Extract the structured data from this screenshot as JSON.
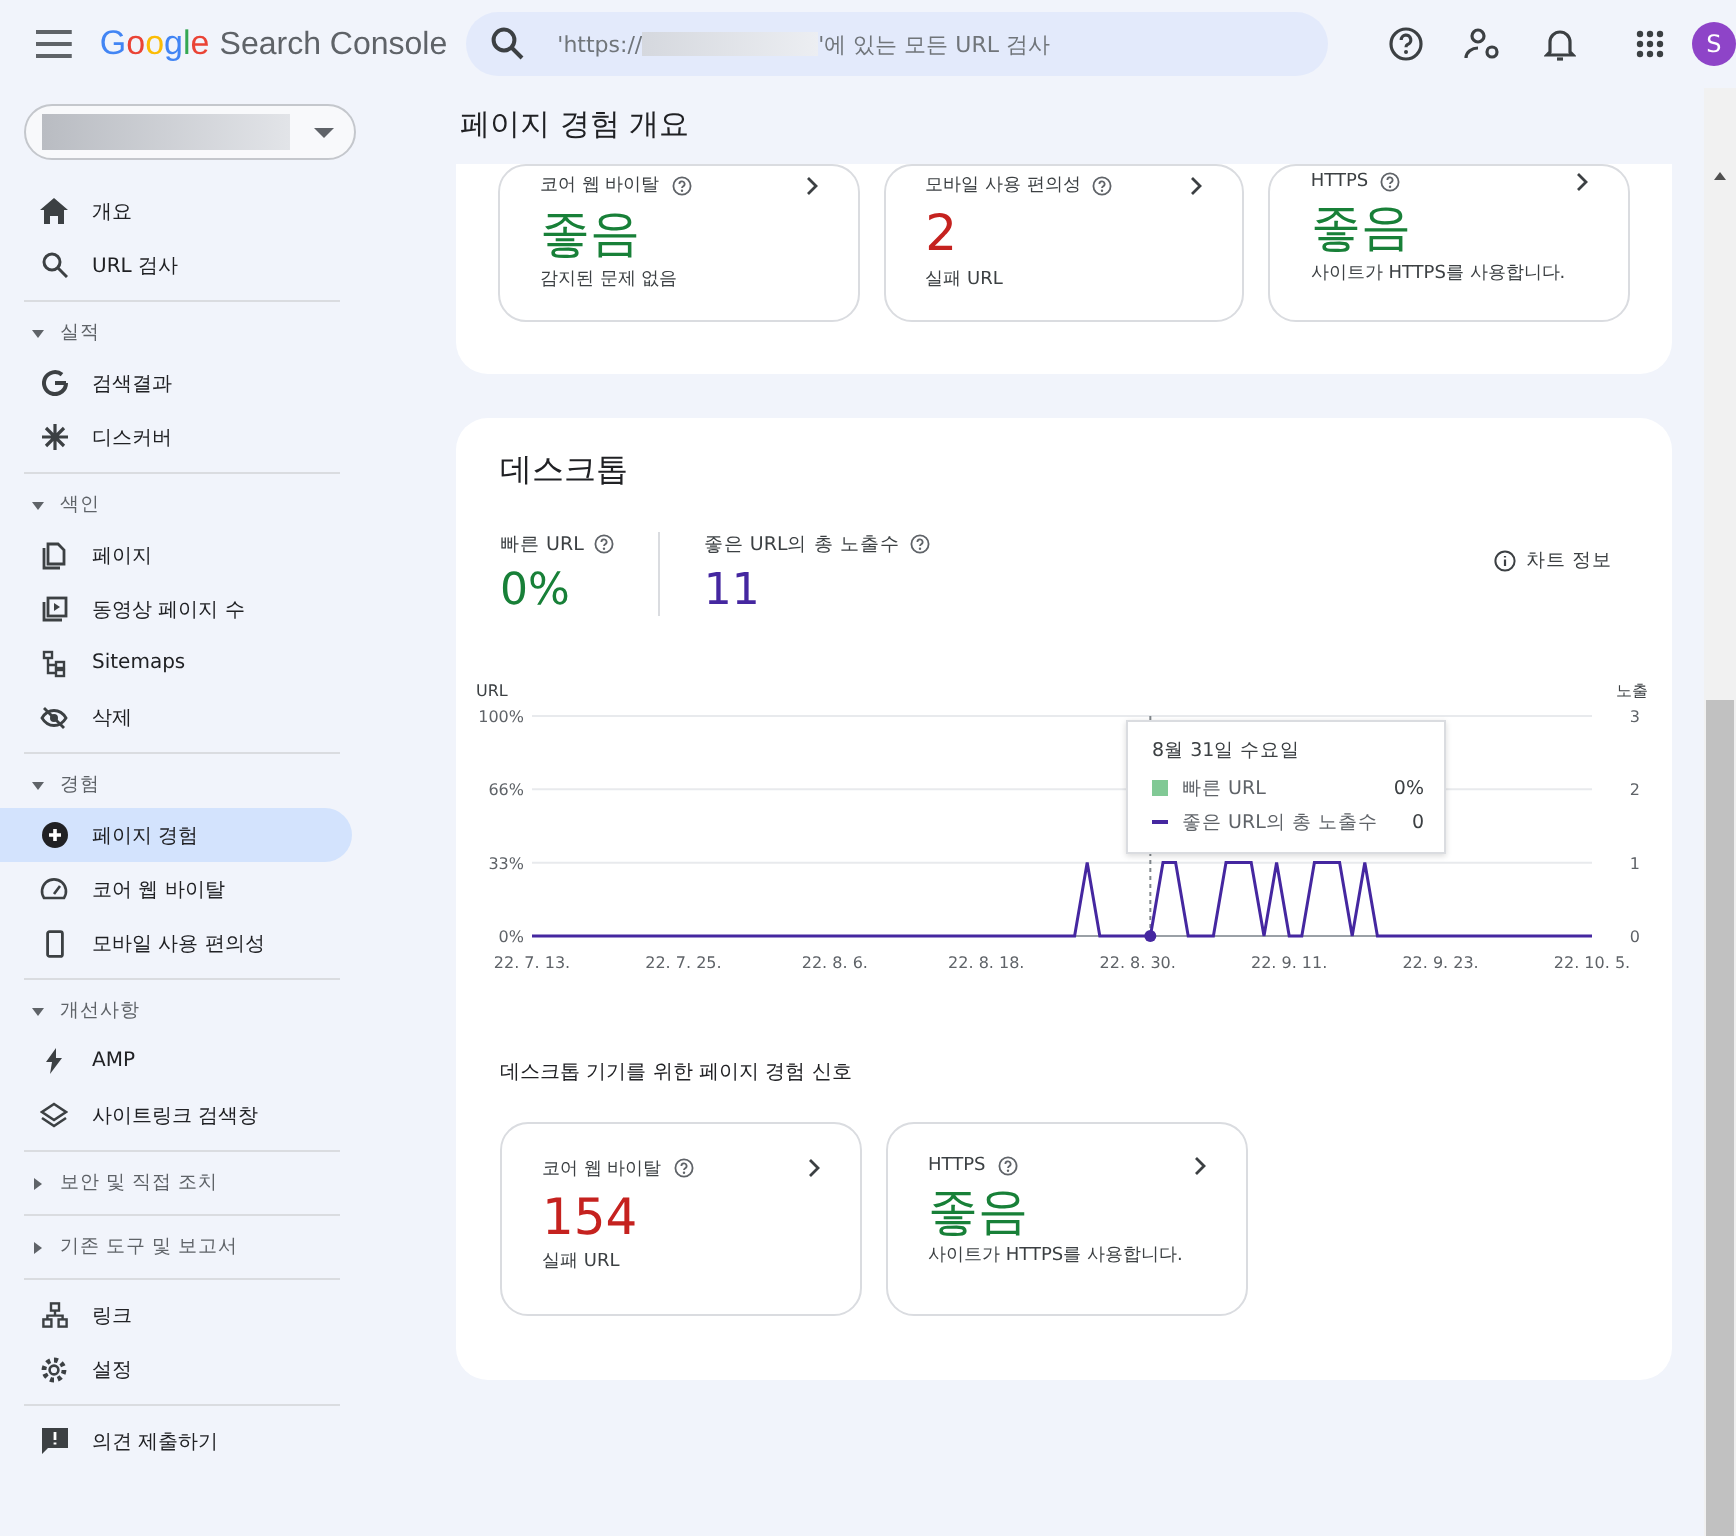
{
  "header": {
    "logo": {
      "brand": "Google",
      "product": "Search Console"
    },
    "search": {
      "prefix": "'https://",
      "suffix": "'에 있는 모든 URL 검사"
    },
    "avatar": "S"
  },
  "sidebar": {
    "top": [
      {
        "label": "개요",
        "selected": false
      },
      {
        "label": "URL 검사",
        "selected": false
      }
    ],
    "groups": [
      {
        "heading": "실적",
        "expanded": true,
        "items": [
          {
            "label": "검색결과",
            "selected": false
          },
          {
            "label": "디스커버",
            "selected": false
          }
        ]
      },
      {
        "heading": "색인",
        "expanded": true,
        "items": [
          {
            "label": "페이지",
            "selected": false
          },
          {
            "label": "동영상 페이지 수",
            "selected": false
          },
          {
            "label": "Sitemaps",
            "selected": false
          },
          {
            "label": "삭제",
            "selected": false
          }
        ]
      },
      {
        "heading": "경험",
        "expanded": true,
        "items": [
          {
            "label": "페이지 경험",
            "selected": true
          },
          {
            "label": "코어 웹 바이탈",
            "selected": false
          },
          {
            "label": "모바일 사용 편의성",
            "selected": false
          }
        ]
      },
      {
        "heading": "개선사항",
        "expanded": true,
        "items": [
          {
            "label": "AMP",
            "selected": false
          },
          {
            "label": "사이트링크 검색창",
            "selected": false
          }
        ]
      },
      {
        "heading": "보안 및 직접 조치",
        "expanded": false
      },
      {
        "heading": "기존 도구 및 보고서",
        "expanded": false
      }
    ],
    "bottom": [
      {
        "label": "링크",
        "selected": false
      },
      {
        "label": "설정",
        "selected": false
      }
    ],
    "footer": [
      {
        "label": "의견 제출하기",
        "selected": false
      }
    ]
  },
  "page_title": "페이지 경험 개요",
  "overview_cards": [
    {
      "title": "코어 웹 바이탈",
      "value": "좋음",
      "color": "#188038",
      "note": "감지된 문제 없음"
    },
    {
      "title": "모바일 사용 편의성",
      "value": "2",
      "color": "#c5221f",
      "note": "실패 URL"
    },
    {
      "title": "HTTPS",
      "value": "좋음",
      "color": "#188038",
      "note": "사이트가 HTTPS를 사용합니다."
    }
  ],
  "desktop": {
    "title": "데스크톱",
    "metrics": [
      {
        "label": "빠른 URL",
        "value": "0%",
        "color": "#188038"
      },
      {
        "label": "좋은 URL의 총 노출수",
        "value": "11",
        "color": "#4527a0"
      }
    ],
    "chart_info": "차트 정보",
    "chart": {
      "left_label": "URL",
      "left_ticks": [
        "100%",
        "66%",
        "33%",
        "0%"
      ],
      "tooltip": {
        "rows": [
          {
            "kind": "square",
            "color": "#81c995",
            "label": "빠른 URL",
            "value": "0%"
          },
          {
            "kind": "series",
            "value": "0"
          }
        ]
      },
      "chart_data": {
        "type": "line",
        "ylabel": "노출",
        "ylim": [
          0,
          3
        ],
        "yticks": [
          0,
          1,
          2,
          3
        ],
        "categories": [
          "22. 7. 13.",
          null,
          null,
          null,
          null,
          null,
          null,
          null,
          null,
          null,
          null,
          null,
          "22. 7. 25.",
          null,
          null,
          null,
          null,
          null,
          null,
          null,
          null,
          null,
          null,
          null,
          "22. 8. 6.",
          null,
          null,
          null,
          null,
          null,
          null,
          null,
          null,
          null,
          null,
          null,
          "22. 8. 18.",
          null,
          null,
          null,
          null,
          null,
          null,
          null,
          null,
          null,
          null,
          null,
          "22. 8. 30.",
          null,
          null,
          null,
          null,
          null,
          null,
          null,
          null,
          null,
          null,
          null,
          "22. 9. 11.",
          null,
          null,
          null,
          null,
          null,
          null,
          null,
          null,
          null,
          null,
          null,
          "22. 9. 23.",
          null,
          null,
          null,
          null,
          null,
          null,
          null,
          null,
          null,
          null,
          null,
          "22. 10. 5."
        ],
        "series": [
          {
            "name": "좋은 URL의 총 노출수",
            "color": "#4527a0",
            "values": [
              0,
              0,
              0,
              0,
              0,
              0,
              0,
              0,
              0,
              0,
              0,
              0,
              0,
              0,
              0,
              0,
              0,
              0,
              0,
              0,
              0,
              0,
              0,
              0,
              0,
              0,
              0,
              0,
              0,
              0,
              0,
              0,
              0,
              0,
              0,
              0,
              0,
              0,
              0,
              0,
              0,
              0,
              0,
              0,
              1,
              0,
              0,
              0,
              0,
              0,
              1,
              1,
              0,
              0,
              0,
              1,
              1,
              1,
              0,
              1,
              0,
              0,
              1,
              1,
              1,
              0,
              1,
              0,
              0,
              0,
              0,
              0,
              0,
              0,
              0,
              0,
              0,
              0,
              0,
              0,
              0,
              0,
              0,
              0,
              0
            ]
          }
        ],
        "annotations": [
          "8월 31일 수요일"
        ]
      }
    },
    "signals_title": "데스크톱 기기를 위한 페이지 경험 신호",
    "cards": [
      {
        "title": "코어 웹 바이탈",
        "value": "154",
        "color": "#c5221f",
        "note": "실패 URL"
      },
      {
        "title": "HTTPS",
        "value": "좋음",
        "color": "#188038",
        "note": "사이트가 HTTPS를 사용합니다."
      }
    ]
  }
}
